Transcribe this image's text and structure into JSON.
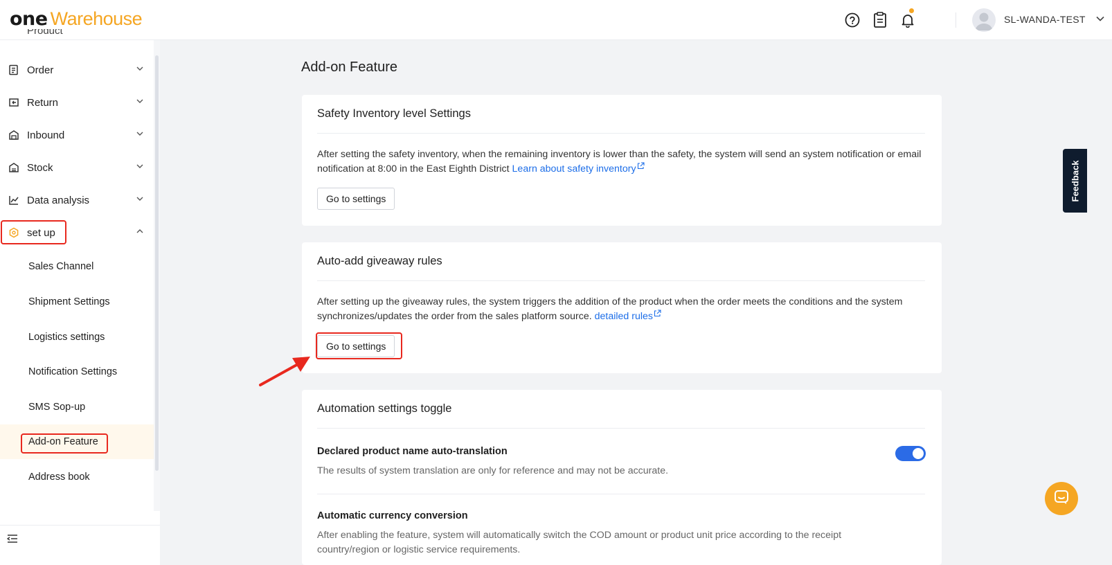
{
  "header": {
    "logo_one": "one",
    "logo_warehouse": "Warehouse",
    "username": "SL-WANDA-TEST",
    "colors": {
      "brand": "#f5a623",
      "dark": "#1a1a1a"
    },
    "icons": [
      "help-circle-icon",
      "clipboard-icon",
      "bell-icon",
      "user-avatar-icon",
      "chevron-down-icon"
    ]
  },
  "sidebar": {
    "partial_item": "Product",
    "items": [
      {
        "label": "Order",
        "icon": "order-icon"
      },
      {
        "label": "Return",
        "icon": "return-icon"
      },
      {
        "label": "Inbound",
        "icon": "inbound-icon"
      },
      {
        "label": "Stock",
        "icon": "stock-icon"
      },
      {
        "label": "Data analysis",
        "icon": "chart-icon"
      },
      {
        "label": "set up",
        "icon": "hexagon-gear-icon"
      }
    ],
    "submenu": [
      {
        "label": "Sales Channel"
      },
      {
        "label": "Shipment Settings"
      },
      {
        "label": "Logistics settings"
      },
      {
        "label": "Notification Settings"
      },
      {
        "label": "SMS Sop-up"
      },
      {
        "label": "Add-on Feature"
      },
      {
        "label": "Address book"
      }
    ]
  },
  "main": {
    "title": "Add-on Feature",
    "cards": [
      {
        "title": "Safety Inventory level Settings",
        "desc": "After setting the safety inventory, when the remaining inventory is lower than the safety, the system will send an system notification or email notification at 8:00 in the East Eighth District",
        "link": "Learn about safety inventory",
        "button": "Go to settings"
      },
      {
        "title": "Auto-add giveaway rules",
        "desc": "After setting up the giveaway rules, the system triggers the addition of the product when the order meets the conditions and the system synchronizes/updates the order from the sales platform source.",
        "link": "detailed rules",
        "button": "Go to settings"
      },
      {
        "title": "Automation settings toggle",
        "settings": [
          {
            "title": "Declared product name auto-translation",
            "desc": "The results of system translation are only for reference and may not be accurate.",
            "enabled": true
          },
          {
            "title": "Automatic currency conversion",
            "desc": "After enabling the feature, system will automatically switch the COD amount or product unit price according to the receipt country/region or logistic service requirements."
          }
        ]
      }
    ]
  },
  "widgets": {
    "feedback": "Feedback"
  }
}
